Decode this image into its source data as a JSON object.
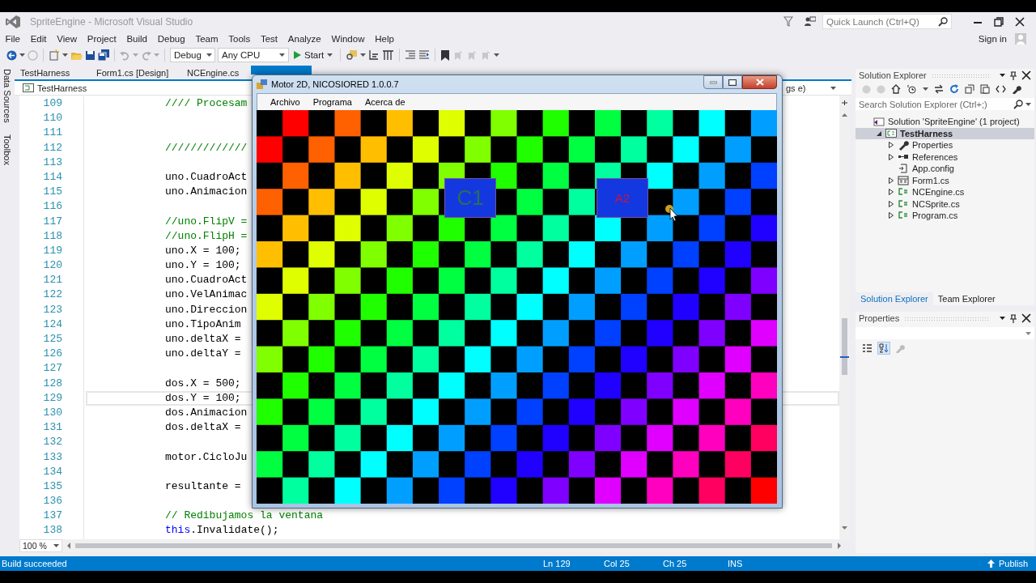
{
  "window": {
    "title": "SpriteEngine - Microsoft Visual Studio"
  },
  "quick_launch": {
    "placeholder": "Quick Launch (Ctrl+Q)"
  },
  "menu": [
    "File",
    "Edit",
    "View",
    "Project",
    "Build",
    "Debug",
    "Team",
    "Tools",
    "Test",
    "Analyze",
    "Window",
    "Help"
  ],
  "sign_in": "Sign in",
  "toolbar": {
    "configuration": "Debug",
    "platform": "Any CPU",
    "start": "Start"
  },
  "side_tabs": [
    "Data Sources",
    "Toolbox"
  ],
  "document_tabs": [
    {
      "label": "TestHarness",
      "selected": false
    },
    {
      "label": "Form1.cs [Design]",
      "selected": false
    },
    {
      "label": "NCEngine.cs",
      "selected": false
    },
    {
      "selected": true
    }
  ],
  "editor": {
    "nav_left": "TestHarness",
    "nav_right": "gs e)",
    "zoom": "100 %",
    "lines": [
      {
        "number": "109",
        "current": false,
        "segments": [
          {
            "kind": "comment",
            "text": "//// Procesam"
          }
        ]
      },
      {
        "number": "110",
        "current": false
      },
      {
        "number": "111",
        "current": false
      },
      {
        "number": "112",
        "current": false,
        "segments": [
          {
            "kind": "comment",
            "text": "/////////////"
          }
        ]
      },
      {
        "number": "113",
        "current": false
      },
      {
        "number": "114",
        "current": false,
        "segments": [
          {
            "kind": "code",
            "text": "uno.CuadroAct"
          }
        ]
      },
      {
        "number": "115",
        "current": false,
        "segments": [
          {
            "kind": "code",
            "text": "uno.Animacion"
          }
        ]
      },
      {
        "number": "116",
        "current": false
      },
      {
        "number": "117",
        "current": false,
        "segments": [
          {
            "kind": "comment",
            "text": "//uno.FlipV ="
          }
        ]
      },
      {
        "number": "118",
        "current": false,
        "segments": [
          {
            "kind": "comment",
            "text": "//uno.FlipH ="
          }
        ]
      },
      {
        "number": "119",
        "current": false,
        "segments": [
          {
            "kind": "code",
            "text": "uno.X = 100;"
          }
        ]
      },
      {
        "number": "120",
        "current": false,
        "segments": [
          {
            "kind": "code",
            "text": "uno.Y = 100;"
          }
        ]
      },
      {
        "number": "121",
        "current": false,
        "segments": [
          {
            "kind": "code",
            "text": "uno.CuadroAct"
          }
        ]
      },
      {
        "number": "122",
        "current": false,
        "segments": [
          {
            "kind": "code",
            "text": "uno.VelAnimac"
          }
        ]
      },
      {
        "number": "123",
        "current": false,
        "segments": [
          {
            "kind": "code",
            "text": "uno.Direccion"
          }
        ]
      },
      {
        "number": "124",
        "current": false,
        "segments": [
          {
            "kind": "code",
            "text": "uno.TipoAnim"
          }
        ]
      },
      {
        "number": "125",
        "current": false,
        "segments": [
          {
            "kind": "code",
            "text": "uno.deltaX ="
          }
        ]
      },
      {
        "number": "126",
        "current": false,
        "segments": [
          {
            "kind": "code",
            "text": "uno.deltaY ="
          }
        ]
      },
      {
        "number": "127",
        "current": false
      },
      {
        "number": "128",
        "current": false,
        "segments": [
          {
            "kind": "code",
            "text": "dos.X = 500;"
          }
        ]
      },
      {
        "number": "129",
        "current": true,
        "segments": [
          {
            "kind": "code",
            "text": "dos.Y = 100;"
          }
        ]
      },
      {
        "number": "130",
        "current": false,
        "segments": [
          {
            "kind": "code",
            "text": "dos.Animacion"
          }
        ]
      },
      {
        "number": "131",
        "current": false,
        "segments": [
          {
            "kind": "code",
            "text": "dos.deltaX ="
          }
        ]
      },
      {
        "number": "132",
        "current": false
      },
      {
        "number": "133",
        "current": false,
        "segments": [
          {
            "kind": "code",
            "text": "motor.CicloJu"
          }
        ]
      },
      {
        "number": "134",
        "current": false
      },
      {
        "number": "135",
        "current": false,
        "segments": [
          {
            "kind": "code",
            "text": "resultante ="
          }
        ]
      },
      {
        "number": "136",
        "current": false
      },
      {
        "number": "137",
        "current": false,
        "segments": [
          {
            "kind": "comment",
            "text": "// Redibujamos la ventana"
          }
        ]
      },
      {
        "number": "138",
        "current": false,
        "segments": [
          {
            "kind": "keyword",
            "text": "this"
          },
          {
            "kind": "code",
            "text": ".Invalidate();"
          }
        ]
      }
    ]
  },
  "game_window": {
    "title": "Motor 2D, NICOSIORED 1.0.0.7",
    "menu": [
      "Archivo",
      "Programa",
      "Acerca de"
    ],
    "sprites": [
      {
        "label": "C1"
      },
      {
        "label": "A2"
      }
    ]
  },
  "solution_explorer": {
    "title": "Solution Explorer",
    "search_placeholder": "Search Solution Explorer (Ctrl+;)",
    "tree": [
      {
        "label": "Solution 'SpriteEngine' (1 project)",
        "kind": "solution",
        "selected": false,
        "children": [
          {
            "label": "TestHarness",
            "kind": "project",
            "expanded": true,
            "selected": true,
            "children": [
              {
                "label": "Properties",
                "kind": "properties",
                "expanded": false,
                "selected": false
              },
              {
                "label": "References",
                "kind": "references",
                "expanded": false,
                "selected": false
              },
              {
                "label": "App.config",
                "kind": "config",
                "selected": false
              },
              {
                "label": "Form1.cs",
                "kind": "form",
                "expanded": false,
                "selected": false
              },
              {
                "label": "NCEngine.cs",
                "kind": "csharp",
                "expanded": false,
                "selected": false
              },
              {
                "label": "NCSprite.cs",
                "kind": "csharp",
                "expanded": false,
                "selected": false
              },
              {
                "label": "Program.cs",
                "kind": "csharp",
                "expanded": false,
                "selected": false
              }
            ]
          }
        ]
      }
    ],
    "tabs": [
      {
        "label": "Solution Explorer",
        "selected": true
      },
      {
        "label": "Team Explorer",
        "selected": false
      }
    ]
  },
  "properties": {
    "title": "Properties"
  },
  "status_bar": {
    "message": "Build succeeded",
    "line": "Ln 129",
    "column": "Col 25",
    "char": "Ch 25",
    "mode": "INS",
    "publish": "Publish"
  }
}
